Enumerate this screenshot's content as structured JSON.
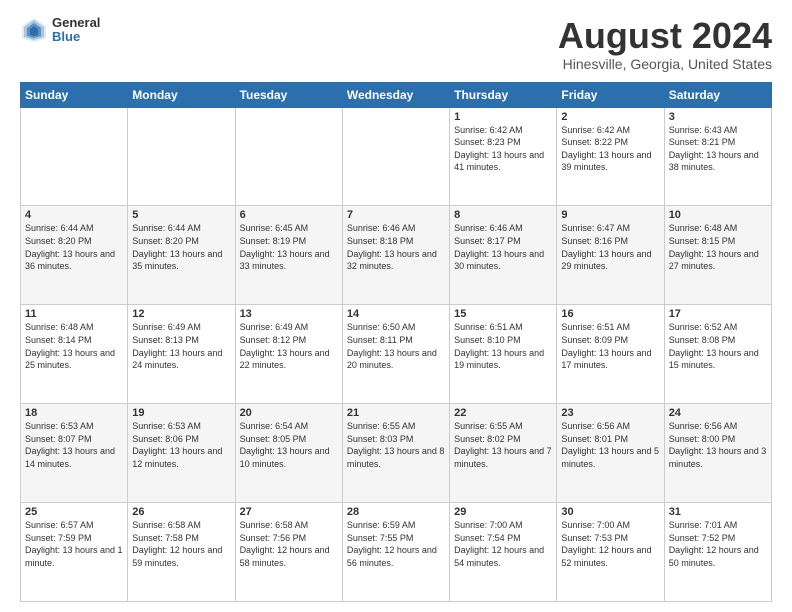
{
  "logo": {
    "general": "General",
    "blue": "Blue"
  },
  "header": {
    "month": "August 2024",
    "location": "Hinesville, Georgia, United States"
  },
  "weekdays": [
    "Sunday",
    "Monday",
    "Tuesday",
    "Wednesday",
    "Thursday",
    "Friday",
    "Saturday"
  ],
  "weeks": [
    [
      {
        "day": "",
        "sunrise": "",
        "sunset": "",
        "daylight": ""
      },
      {
        "day": "",
        "sunrise": "",
        "sunset": "",
        "daylight": ""
      },
      {
        "day": "",
        "sunrise": "",
        "sunset": "",
        "daylight": ""
      },
      {
        "day": "",
        "sunrise": "",
        "sunset": "",
        "daylight": ""
      },
      {
        "day": "1",
        "sunrise": "Sunrise: 6:42 AM",
        "sunset": "Sunset: 8:23 PM",
        "daylight": "Daylight: 13 hours and 41 minutes."
      },
      {
        "day": "2",
        "sunrise": "Sunrise: 6:42 AM",
        "sunset": "Sunset: 8:22 PM",
        "daylight": "Daylight: 13 hours and 39 minutes."
      },
      {
        "day": "3",
        "sunrise": "Sunrise: 6:43 AM",
        "sunset": "Sunset: 8:21 PM",
        "daylight": "Daylight: 13 hours and 38 minutes."
      }
    ],
    [
      {
        "day": "4",
        "sunrise": "Sunrise: 6:44 AM",
        "sunset": "Sunset: 8:20 PM",
        "daylight": "Daylight: 13 hours and 36 minutes."
      },
      {
        "day": "5",
        "sunrise": "Sunrise: 6:44 AM",
        "sunset": "Sunset: 8:20 PM",
        "daylight": "Daylight: 13 hours and 35 minutes."
      },
      {
        "day": "6",
        "sunrise": "Sunrise: 6:45 AM",
        "sunset": "Sunset: 8:19 PM",
        "daylight": "Daylight: 13 hours and 33 minutes."
      },
      {
        "day": "7",
        "sunrise": "Sunrise: 6:46 AM",
        "sunset": "Sunset: 8:18 PM",
        "daylight": "Daylight: 13 hours and 32 minutes."
      },
      {
        "day": "8",
        "sunrise": "Sunrise: 6:46 AM",
        "sunset": "Sunset: 8:17 PM",
        "daylight": "Daylight: 13 hours and 30 minutes."
      },
      {
        "day": "9",
        "sunrise": "Sunrise: 6:47 AM",
        "sunset": "Sunset: 8:16 PM",
        "daylight": "Daylight: 13 hours and 29 minutes."
      },
      {
        "day": "10",
        "sunrise": "Sunrise: 6:48 AM",
        "sunset": "Sunset: 8:15 PM",
        "daylight": "Daylight: 13 hours and 27 minutes."
      }
    ],
    [
      {
        "day": "11",
        "sunrise": "Sunrise: 6:48 AM",
        "sunset": "Sunset: 8:14 PM",
        "daylight": "Daylight: 13 hours and 25 minutes."
      },
      {
        "day": "12",
        "sunrise": "Sunrise: 6:49 AM",
        "sunset": "Sunset: 8:13 PM",
        "daylight": "Daylight: 13 hours and 24 minutes."
      },
      {
        "day": "13",
        "sunrise": "Sunrise: 6:49 AM",
        "sunset": "Sunset: 8:12 PM",
        "daylight": "Daylight: 13 hours and 22 minutes."
      },
      {
        "day": "14",
        "sunrise": "Sunrise: 6:50 AM",
        "sunset": "Sunset: 8:11 PM",
        "daylight": "Daylight: 13 hours and 20 minutes."
      },
      {
        "day": "15",
        "sunrise": "Sunrise: 6:51 AM",
        "sunset": "Sunset: 8:10 PM",
        "daylight": "Daylight: 13 hours and 19 minutes."
      },
      {
        "day": "16",
        "sunrise": "Sunrise: 6:51 AM",
        "sunset": "Sunset: 8:09 PM",
        "daylight": "Daylight: 13 hours and 17 minutes."
      },
      {
        "day": "17",
        "sunrise": "Sunrise: 6:52 AM",
        "sunset": "Sunset: 8:08 PM",
        "daylight": "Daylight: 13 hours and 15 minutes."
      }
    ],
    [
      {
        "day": "18",
        "sunrise": "Sunrise: 6:53 AM",
        "sunset": "Sunset: 8:07 PM",
        "daylight": "Daylight: 13 hours and 14 minutes."
      },
      {
        "day": "19",
        "sunrise": "Sunrise: 6:53 AM",
        "sunset": "Sunset: 8:06 PM",
        "daylight": "Daylight: 13 hours and 12 minutes."
      },
      {
        "day": "20",
        "sunrise": "Sunrise: 6:54 AM",
        "sunset": "Sunset: 8:05 PM",
        "daylight": "Daylight: 13 hours and 10 minutes."
      },
      {
        "day": "21",
        "sunrise": "Sunrise: 6:55 AM",
        "sunset": "Sunset: 8:03 PM",
        "daylight": "Daylight: 13 hours and 8 minutes."
      },
      {
        "day": "22",
        "sunrise": "Sunrise: 6:55 AM",
        "sunset": "Sunset: 8:02 PM",
        "daylight": "Daylight: 13 hours and 7 minutes."
      },
      {
        "day": "23",
        "sunrise": "Sunrise: 6:56 AM",
        "sunset": "Sunset: 8:01 PM",
        "daylight": "Daylight: 13 hours and 5 minutes."
      },
      {
        "day": "24",
        "sunrise": "Sunrise: 6:56 AM",
        "sunset": "Sunset: 8:00 PM",
        "daylight": "Daylight: 13 hours and 3 minutes."
      }
    ],
    [
      {
        "day": "25",
        "sunrise": "Sunrise: 6:57 AM",
        "sunset": "Sunset: 7:59 PM",
        "daylight": "Daylight: 13 hours and 1 minute."
      },
      {
        "day": "26",
        "sunrise": "Sunrise: 6:58 AM",
        "sunset": "Sunset: 7:58 PM",
        "daylight": "Daylight: 12 hours and 59 minutes."
      },
      {
        "day": "27",
        "sunrise": "Sunrise: 6:58 AM",
        "sunset": "Sunset: 7:56 PM",
        "daylight": "Daylight: 12 hours and 58 minutes."
      },
      {
        "day": "28",
        "sunrise": "Sunrise: 6:59 AM",
        "sunset": "Sunset: 7:55 PM",
        "daylight": "Daylight: 12 hours and 56 minutes."
      },
      {
        "day": "29",
        "sunrise": "Sunrise: 7:00 AM",
        "sunset": "Sunset: 7:54 PM",
        "daylight": "Daylight: 12 hours and 54 minutes."
      },
      {
        "day": "30",
        "sunrise": "Sunrise: 7:00 AM",
        "sunset": "Sunset: 7:53 PM",
        "daylight": "Daylight: 12 hours and 52 minutes."
      },
      {
        "day": "31",
        "sunrise": "Sunrise: 7:01 AM",
        "sunset": "Sunset: 7:52 PM",
        "daylight": "Daylight: 12 hours and 50 minutes."
      }
    ]
  ]
}
